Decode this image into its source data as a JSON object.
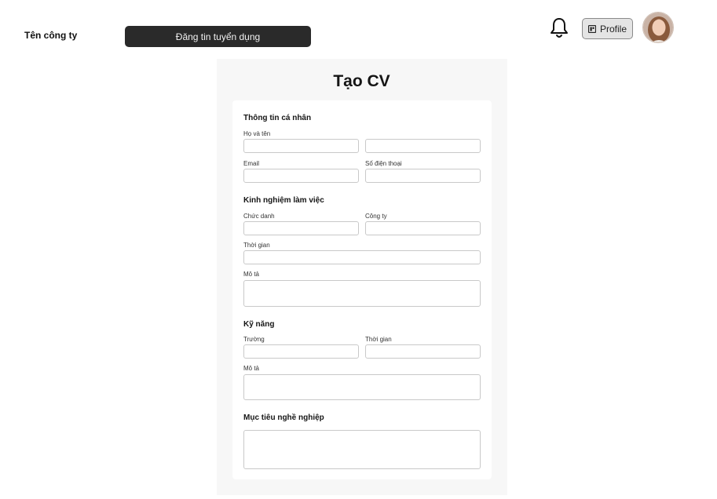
{
  "header": {
    "company_name": "Tên công ty",
    "post_job_label": "Đăng tin tuyển dụng",
    "profile_label": "Profile"
  },
  "form": {
    "title": "Tạo CV",
    "personal": {
      "title": "Thông tin cá nhân",
      "fullname_label": "Họ và tên",
      "email_label": "Email",
      "phone_label": "Số điện thoại"
    },
    "experience": {
      "title": "Kinh nghiệm làm việc",
      "job_title_label": "Chức danh",
      "company_label": "Công ty",
      "duration_label": "Thời gian",
      "description_label": "Mô tả"
    },
    "skills": {
      "title": "Kỹ năng",
      "school_label": "Trường",
      "duration_label": "Thời gian",
      "description_label": "Mô tả"
    },
    "career_goal": {
      "title": "Mục tiêu nghề nghiệp"
    }
  },
  "colors": {
    "dark_button": "#2a2a2a",
    "panel_bg": "#f7f7f7",
    "input_border": "#c9c9c9"
  }
}
